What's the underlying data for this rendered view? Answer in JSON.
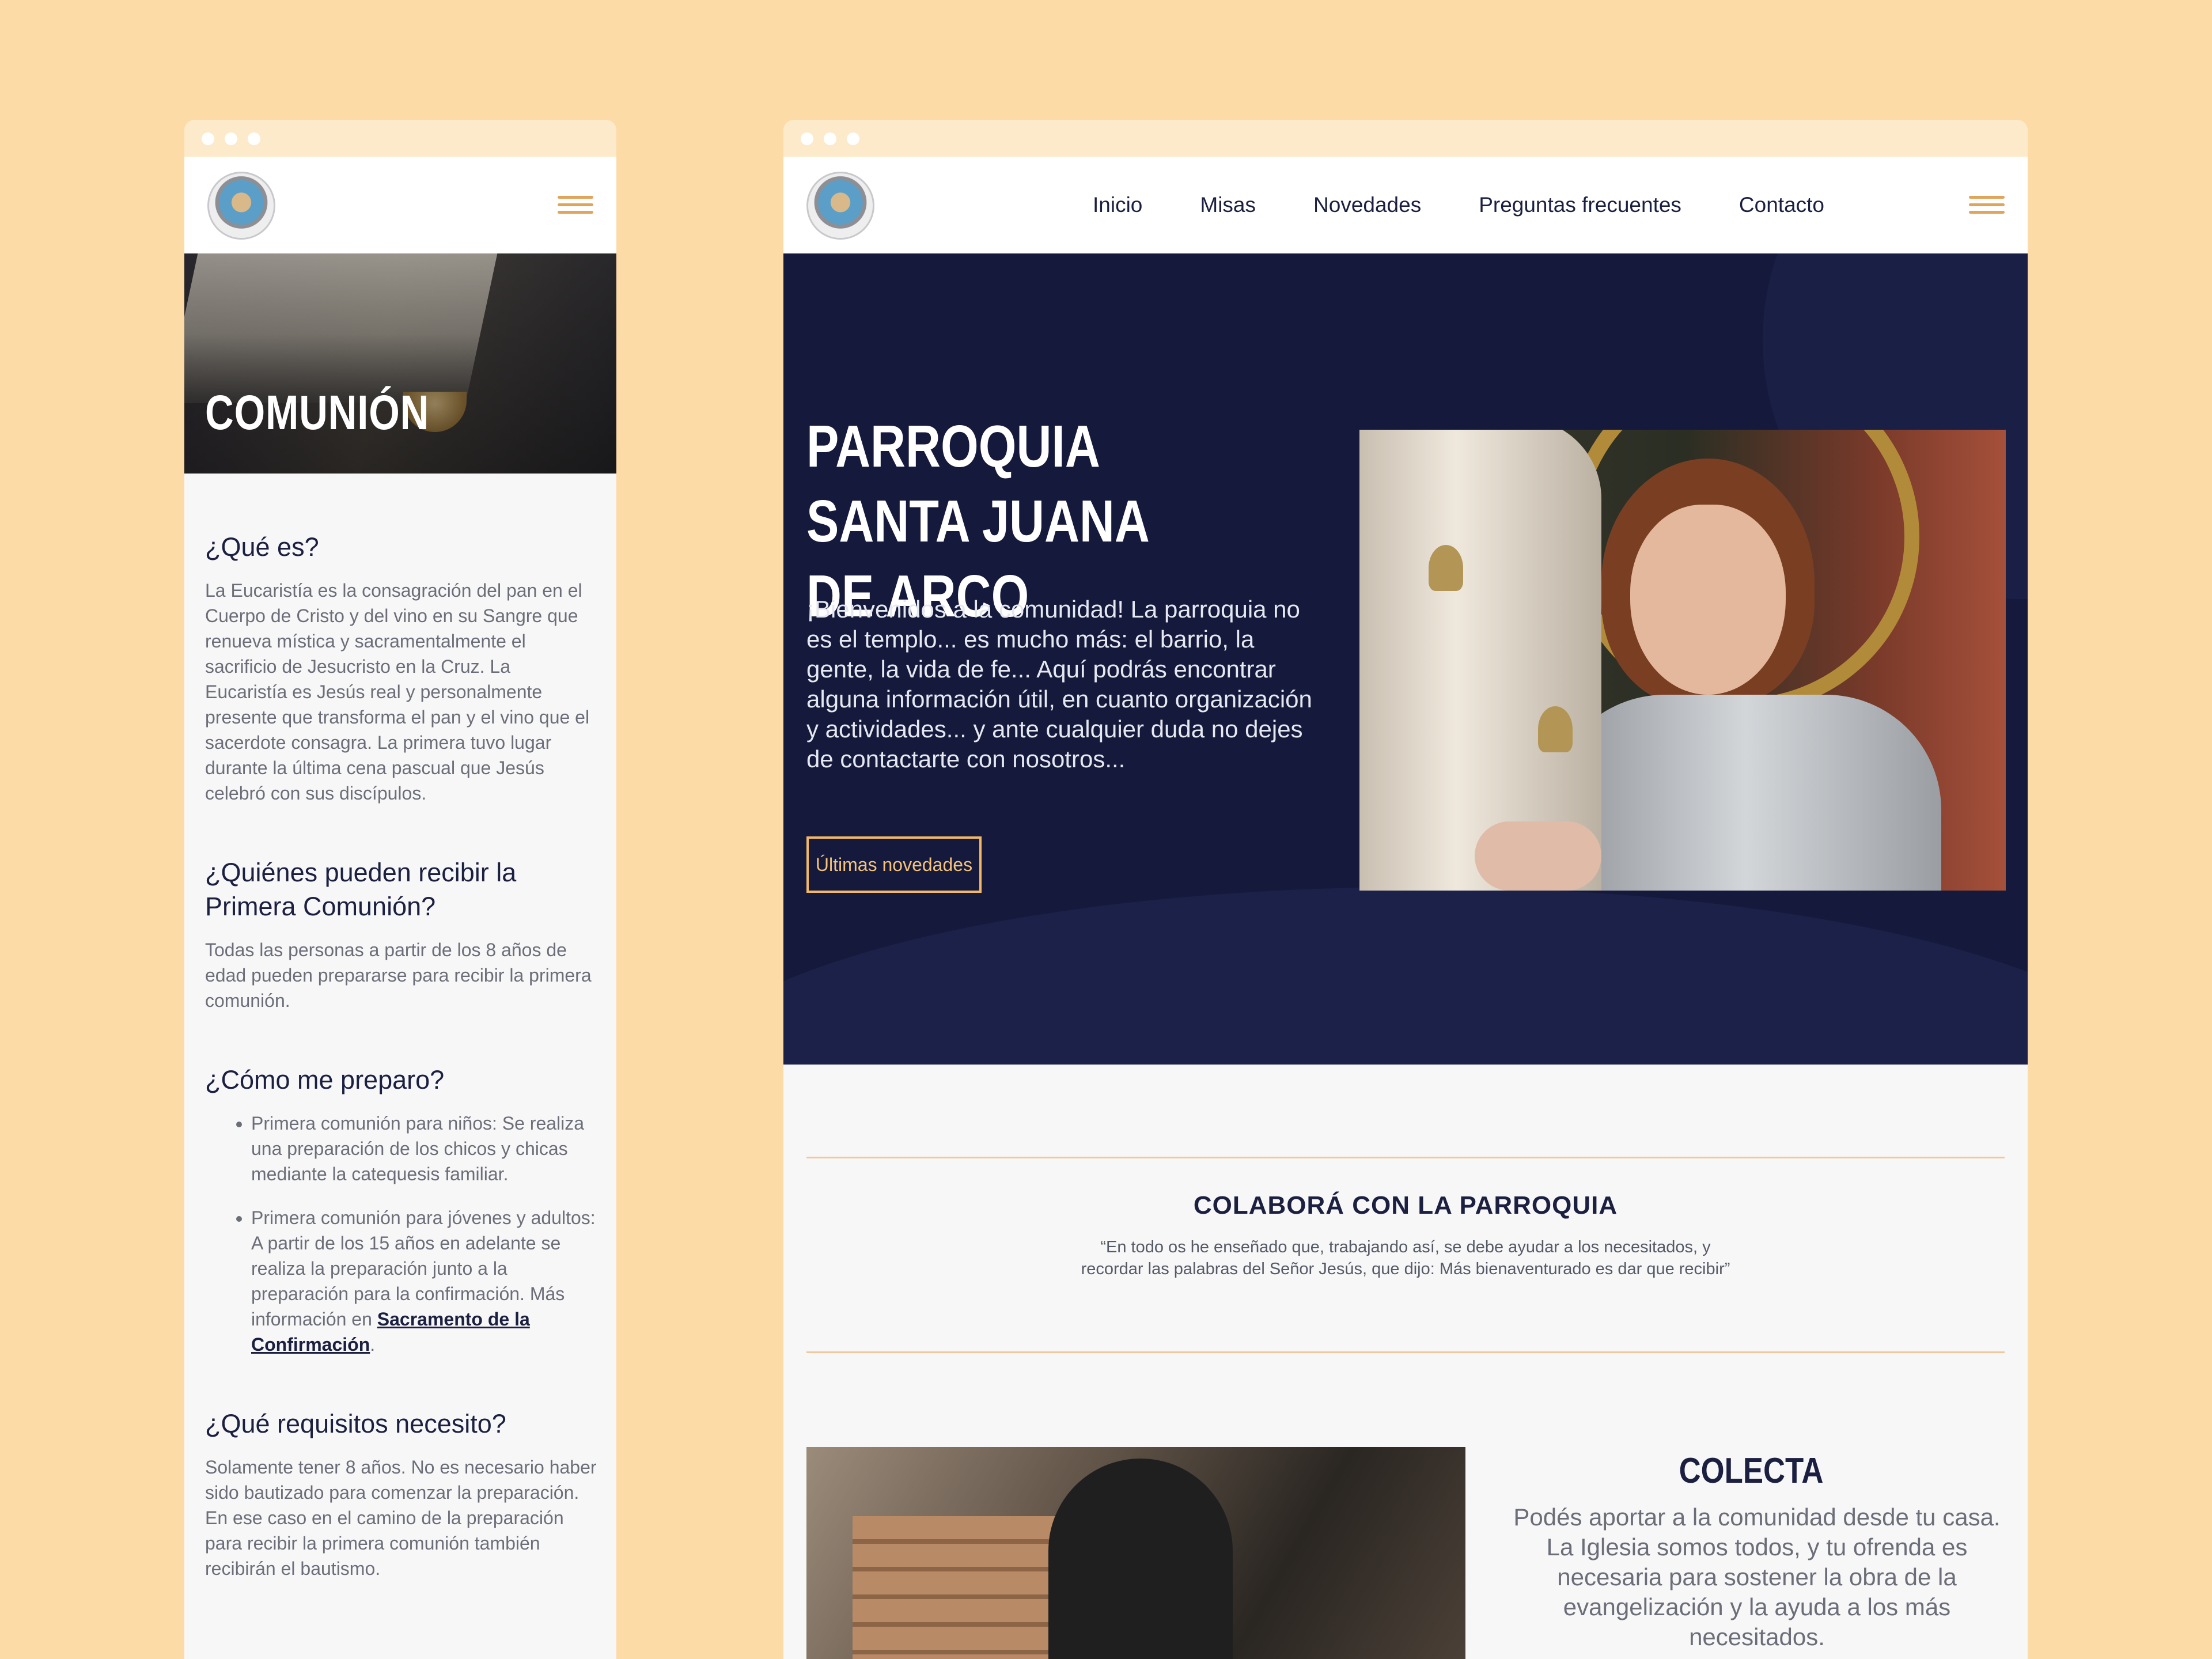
{
  "mobile": {
    "hero_title": "COMUNIÓN",
    "sections": [
      {
        "heading": "¿Qué es?",
        "text": "La Eucaristía es la consagración del pan en el Cuerpo de Cristo y del vino en su Sangre que renueva mística y sacramentalmente el sacrificio de Jesucristo en la Cruz. La Eucaristía es Jesús real y personalmente presente que transforma el pan y el vino que el sacerdote consagra. La primera tuvo lugar durante la última cena pascual que Jesús celebró con sus discípulos."
      },
      {
        "heading": "¿Quiénes pueden recibir la Primera Comunión?",
        "text": "Todas las personas a partir de los 8 años de edad pueden prepararse para recibir la primera comunión."
      },
      {
        "heading": "¿Cómo me preparo?",
        "items": [
          "Primera comunión para niños: Se realiza una preparación de los chicos y chicas mediante la catequesis familiar.",
          "Primera comunión para jóvenes y adultos: A partir de los 15 años en adelante se realiza la preparación junto a la preparación para la confirmación. Más información en"
        ],
        "link": "Sacramento de la Confirmación",
        "link_suffix": "."
      },
      {
        "heading": "¿Qué requisitos necesito?",
        "text": "Solamente tener 8 años. No es necesario haber sido bautizado para comenzar la preparación. En ese caso en el camino de la preparación para recibir la primera comunión también recibirán el bautismo."
      }
    ]
  },
  "desktop": {
    "nav": [
      "Inicio",
      "Misas",
      "Novedades",
      "Preguntas frecuentes",
      "Contacto"
    ],
    "hero": {
      "title": "PARROQUIA SANTA JUANA DE ARCO",
      "text": "¡Bienvenidos a la comunidad! La parroquia no es el templo... es mucho más: el barrio, la gente, la vida de fe... Aquí podrás encontrar alguna información útil, en cuanto organización y actividades... y ante cualquier duda no dejes de contactarte con nosotros...",
      "button": "Últimas novedades"
    },
    "collab": {
      "title": "COLABORÁ CON LA PARROQUIA",
      "quote": "“En todo os he enseñado que, trabajando así, se debe ayudar a los necesitados, y recordar las palabras del Señor Jesús, que dijo: Más bienaventurado es dar que recibir”"
    },
    "colecta": {
      "title": "COLECTA",
      "text": "Podés aportar a la comunidad desde tu casa. La Iglesia somos todos, y tu ofrenda es necesaria para sostener la obra de la evangelización y la ayuda a los más necesitados."
    }
  },
  "colors": {
    "background": "#FCDBA6",
    "navy": "#151a3d",
    "accent": "#f2b866"
  },
  "icons": [
    "menu-icon",
    "parish-logo"
  ]
}
